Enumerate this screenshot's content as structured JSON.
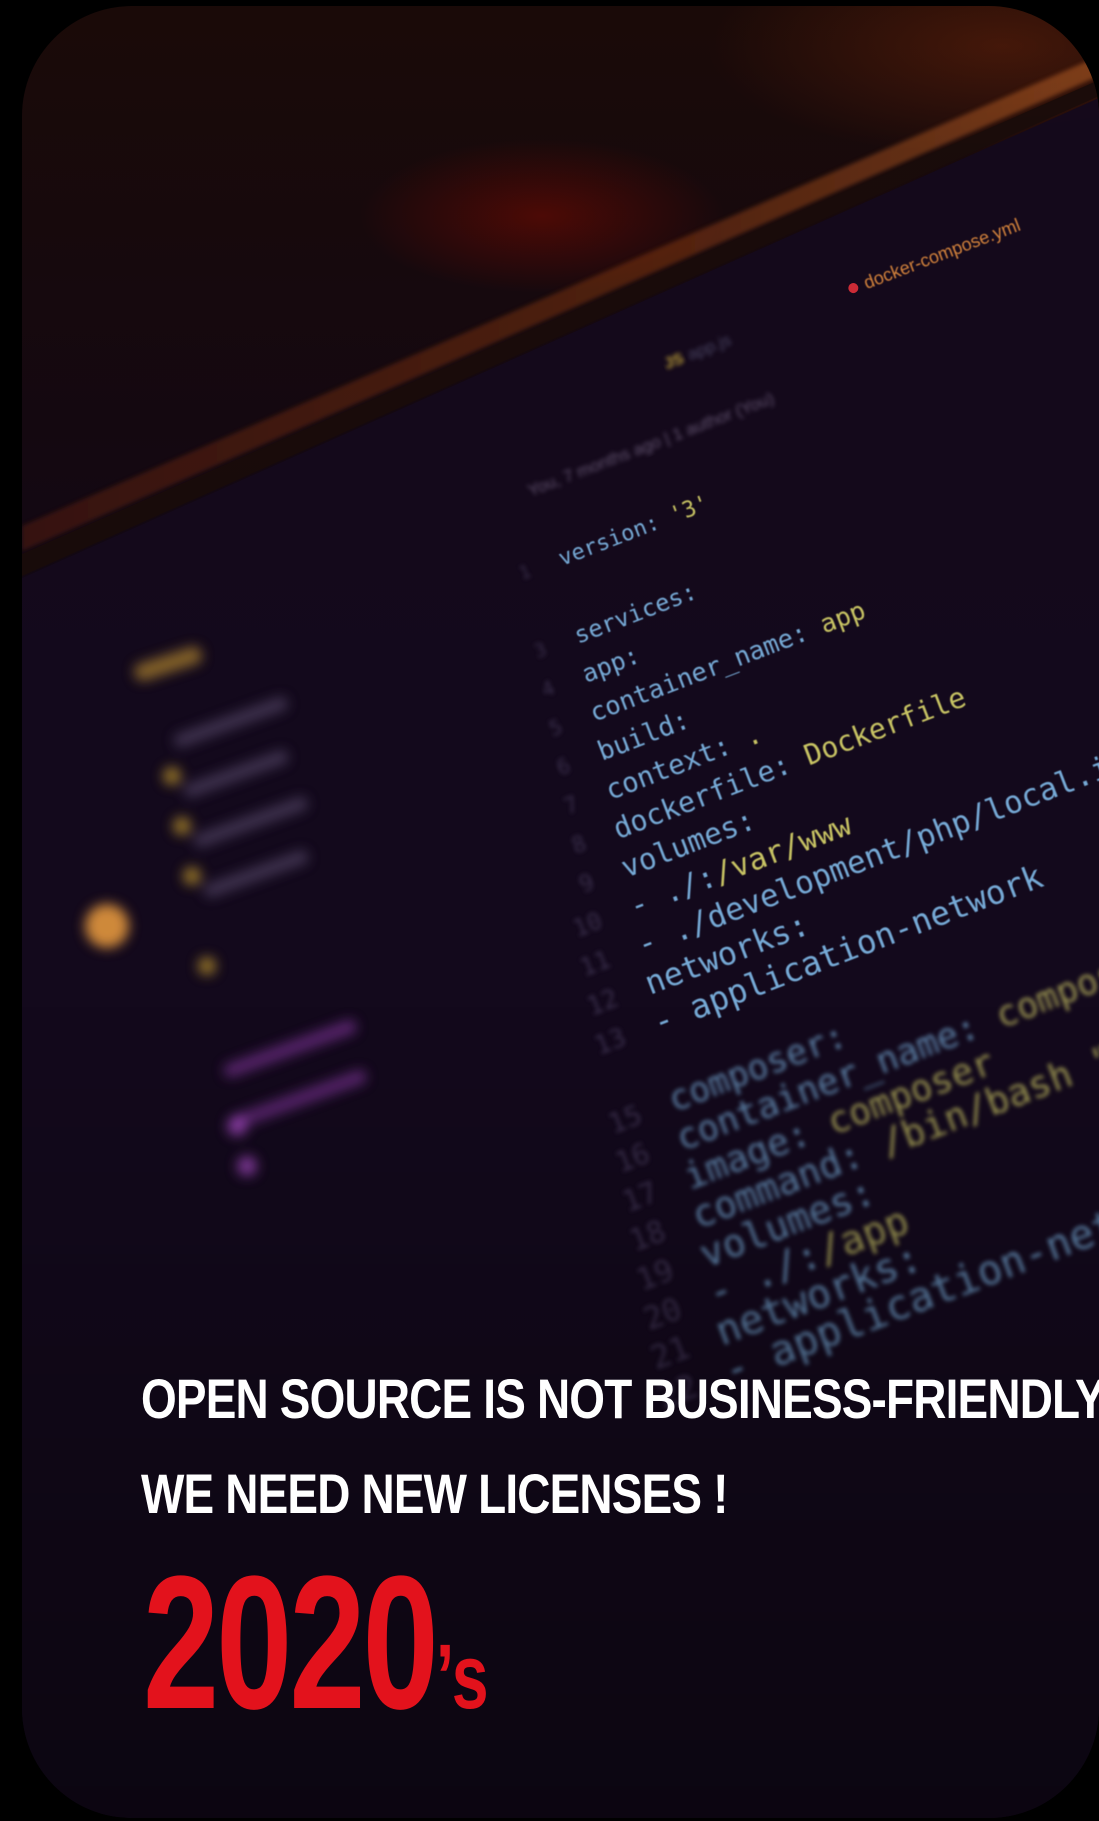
{
  "poster": {
    "line1": "OPEN SOURCE IS NOT BUSINESS-FRIENDLY !",
    "line2": "WE NEED NEW LICENSES !",
    "year": "2020",
    "year_suffix": "’s"
  },
  "editor": {
    "tab_active": "docker-compose.yml",
    "tab_other": "app.js",
    "blame": "You, 7 months ago | 1 author (You)",
    "code_lines": [
      "version: '3'",
      "",
      "services:",
      "  app:",
      "    container_name: app",
      "    build:",
      "      context: .",
      "      dockerfile: Dockerfile",
      "    volumes:",
      "      - ./:/var/www",
      "      - ./development/php/local.ini:/usr/local/",
      "    networks:",
      "      - application-network",
      "",
      "  composer:",
      "    container_name: composer",
      "    image: composer",
      "    command: /bin/bash \"/app/commands/dev",
      "    volumes:",
      "      - ./:/app",
      "    networks:",
      "      - application-network"
    ]
  },
  "colors": {
    "accent_red": "#e3121c",
    "headline_white": "#ffffff",
    "code_key": "#7fb8e6",
    "code_value": "#d8d46a"
  }
}
